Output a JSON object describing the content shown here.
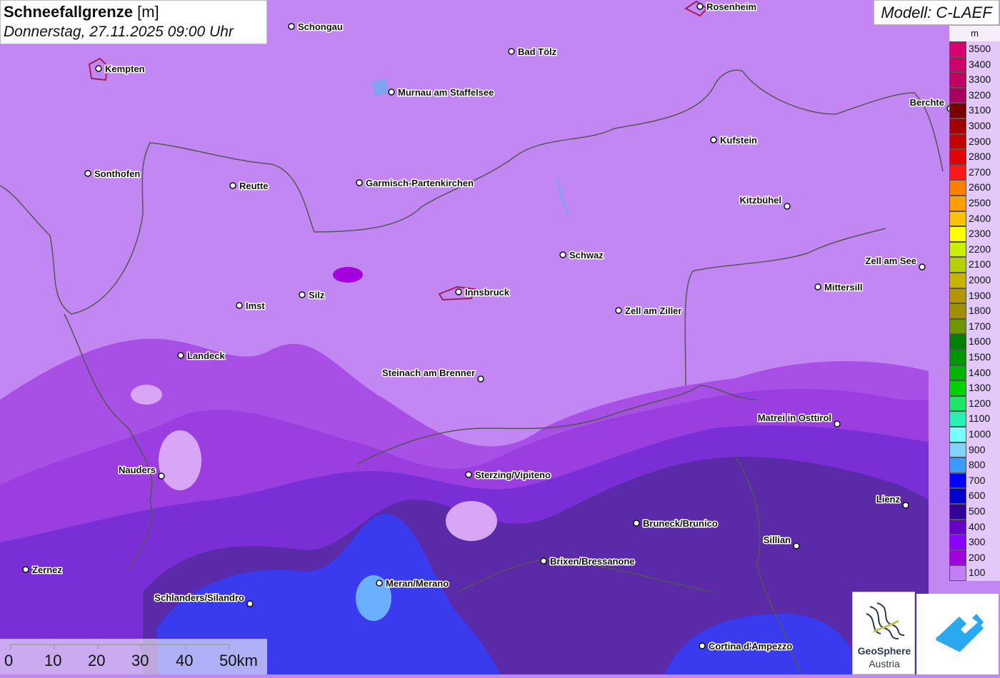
{
  "title": {
    "main": "Schneefallgrenze",
    "unit": "[m]",
    "datetime": "Donnerstag, 27.11.2025 09:00 Uhr"
  },
  "model": "Modell: C-LAEF",
  "legend": {
    "unit": "m",
    "items": [
      {
        "label": "3500",
        "color": "#d6006f"
      },
      {
        "label": "3400",
        "color": "#cc0066"
      },
      {
        "label": "3300",
        "color": "#c0005e"
      },
      {
        "label": "3200",
        "color": "#a80060"
      },
      {
        "label": "3100",
        "color": "#7a0000"
      },
      {
        "label": "3000",
        "color": "#a00000"
      },
      {
        "label": "2900",
        "color": "#c40000"
      },
      {
        "label": "2800",
        "color": "#e00000"
      },
      {
        "label": "2700",
        "color": "#ff1a1a"
      },
      {
        "label": "2600",
        "color": "#ff7f00"
      },
      {
        "label": "2500",
        "color": "#ff9f00"
      },
      {
        "label": "2400",
        "color": "#ffc200"
      },
      {
        "label": "2300",
        "color": "#ffff00"
      },
      {
        "label": "2200",
        "color": "#c8f000"
      },
      {
        "label": "2100",
        "color": "#b4d000"
      },
      {
        "label": "2000",
        "color": "#c8b400"
      },
      {
        "label": "1900",
        "color": "#b49600"
      },
      {
        "label": "1800",
        "color": "#a09000"
      },
      {
        "label": "1700",
        "color": "#6e9600"
      },
      {
        "label": "1600",
        "color": "#008000"
      },
      {
        "label": "1500",
        "color": "#009600"
      },
      {
        "label": "1400",
        "color": "#00b400"
      },
      {
        "label": "1300",
        "color": "#00d200"
      },
      {
        "label": "1200",
        "color": "#1ee664"
      },
      {
        "label": "1100",
        "color": "#28f0b4"
      },
      {
        "label": "1000",
        "color": "#78ffff"
      },
      {
        "label": "900",
        "color": "#82d2ff"
      },
      {
        "label": "800",
        "color": "#3c9bff"
      },
      {
        "label": "700",
        "color": "#0000ff"
      },
      {
        "label": "600",
        "color": "#0000c8"
      },
      {
        "label": "500",
        "color": "#320096"
      },
      {
        "label": "400",
        "color": "#6400c8"
      },
      {
        "label": "300",
        "color": "#8c00ff"
      },
      {
        "label": "200",
        "color": "#a000dc"
      },
      {
        "label": "100",
        "color": "#c27ef2"
      }
    ]
  },
  "cities": [
    {
      "name": "Schongau"
    },
    {
      "name": "Rosenheim"
    },
    {
      "name": "Kempten"
    },
    {
      "name": "Bad Tölz"
    },
    {
      "name": "Murnau am Staffelsee"
    },
    {
      "name": "Berchte"
    },
    {
      "name": "Kufstein"
    },
    {
      "name": "Sonthofen"
    },
    {
      "name": "Reutte"
    },
    {
      "name": "Garmisch-Partenkirchen"
    },
    {
      "name": "Kitzbühel"
    },
    {
      "name": "Schwaz"
    },
    {
      "name": "Zell am See"
    },
    {
      "name": "Innsbruck"
    },
    {
      "name": "Silz"
    },
    {
      "name": "Mittersill"
    },
    {
      "name": "Imst"
    },
    {
      "name": "Zell am Ziller"
    },
    {
      "name": "Landeck"
    },
    {
      "name": "Steinach am Brenner"
    },
    {
      "name": "Matrei in Osttirol"
    },
    {
      "name": "Nauders"
    },
    {
      "name": "Sterzing/Vipiteno"
    },
    {
      "name": "Lienz"
    },
    {
      "name": "Bruneck/Brunico"
    },
    {
      "name": "Sillian"
    },
    {
      "name": "Brixen/Bressanone"
    },
    {
      "name": "Zernez"
    },
    {
      "name": "Meran/Merano"
    },
    {
      "name": "Schlanders/Silandro"
    },
    {
      "name": "Cortina d'Ampezzo"
    }
  ],
  "scale": {
    "labels": [
      "0",
      "10",
      "20",
      "30",
      "40",
      "50km"
    ]
  },
  "logo": {
    "name": "GeoSphere",
    "sub": "Austria"
  }
}
